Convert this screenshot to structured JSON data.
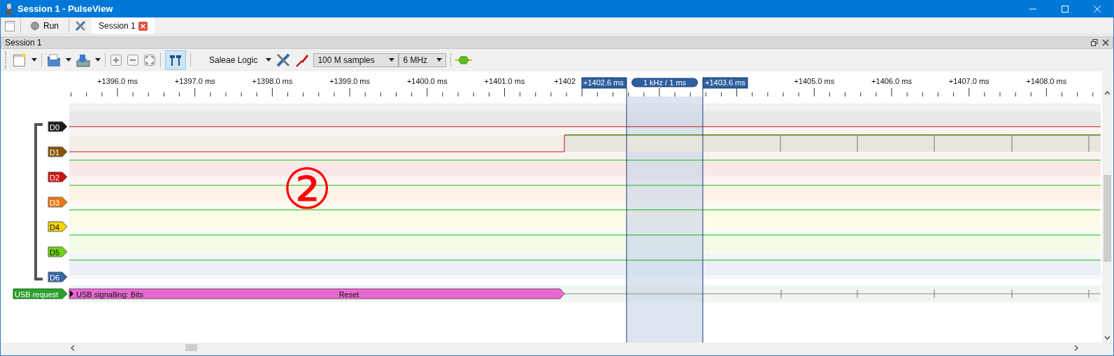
{
  "window": {
    "title": "Session 1 - PulseView"
  },
  "main_toolbar": {
    "run_button": "Run"
  },
  "tabs": [
    {
      "label": "Session 1",
      "selected": true
    }
  ],
  "session_panel": {
    "title": "Session 1"
  },
  "toolbar": {
    "device": "Saleae Logic",
    "samples": "100 M samples",
    "rate": "6 MHz",
    "cursors_shown": true
  },
  "ruler": {
    "labels": [
      "+1396.0 ms",
      "+1397.0 ms",
      "+1398.0 ms",
      "+1399.0 ms",
      "+1400.0 ms",
      "+1401.0 ms",
      "+1402",
      "+1405.0 ms",
      "+1406.0 ms",
      "+1407.0 ms",
      "+1408.0 ms"
    ]
  },
  "cursors": {
    "start": "+1402.6 ms",
    "span": "1 kHz / 1 ms",
    "end": "+1403.6 ms"
  },
  "channels": [
    {
      "name": "D0",
      "color": "#1b1b1b",
      "kind": "low"
    },
    {
      "name": "D1",
      "color": "#8a5508",
      "kind": "rising"
    },
    {
      "name": "D2",
      "color": "#cc1010",
      "kind": "high"
    },
    {
      "name": "D3",
      "color": "#f07810",
      "kind": "high"
    },
    {
      "name": "D4",
      "color": "#f2d400",
      "kind": "high"
    },
    {
      "name": "D5",
      "color": "#73d216",
      "kind": "high"
    },
    {
      "name": "D6",
      "color": "#3465a4",
      "kind": "high"
    }
  ],
  "decoder": {
    "name": "USB request",
    "color": "#2ca02c",
    "row_label": "USB signalling: Bits",
    "annotation": "Reset"
  },
  "annotation_mark": "②"
}
